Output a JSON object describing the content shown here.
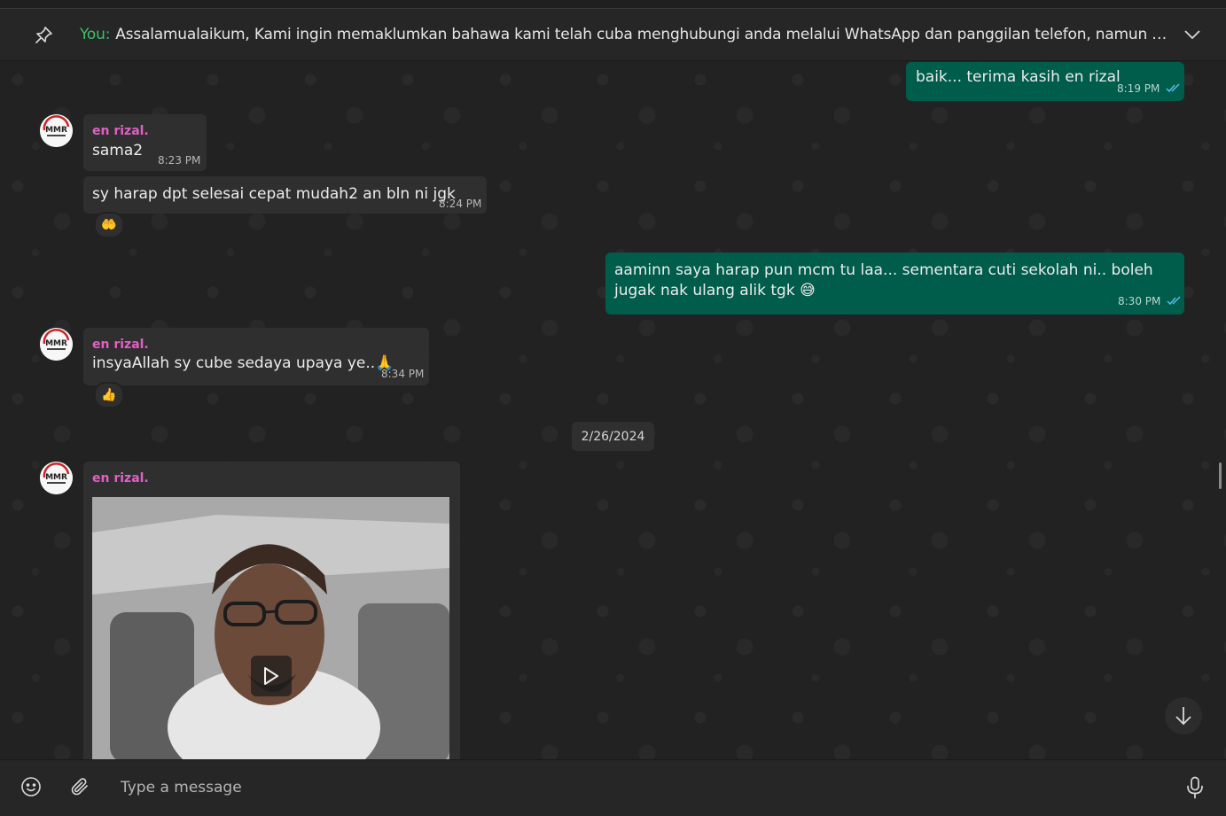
{
  "pinned": {
    "sender": "You:",
    "text": "Assalamualaikum,  Kami ingin memaklumkan bahawa kami telah cuba menghubungi anda melalui WhatsApp dan panggilan telefon, namun tidak mener..."
  },
  "messages": [
    {
      "direction": "out",
      "text": "baik... terima kasih en rizal",
      "time": "8:19 PM"
    },
    {
      "direction": "in",
      "sender": "en rizal.",
      "text": "sama2",
      "time": "8:23 PM"
    },
    {
      "direction": "in",
      "text": "sy harap dpt selesai cepat mudah2 an bln ni jgk",
      "time": "8:24 PM",
      "reaction": "🤲"
    },
    {
      "direction": "out",
      "text": "aaminn saya harap pun mcm tu laa... sementara cuti sekolah ni.. boleh jugak nak ulang alik  tgk 😅",
      "time": "8:30 PM"
    },
    {
      "direction": "in",
      "sender": "en rizal.",
      "text": "insyaAllah sy cube sedaya upaya ye..🙏",
      "time": "8:34 PM",
      "reaction": "👍"
    },
    {
      "direction": "in",
      "sender": "en rizal.",
      "type": "video"
    }
  ],
  "date_divider": "2/26/2024",
  "composer": {
    "placeholder": "Type a message"
  },
  "avatar_text": "MMR",
  "colors": {
    "outgoing_bubble": "#005c4b",
    "incoming_bubble": "#2f2f2f",
    "sender_name": "#e160c4",
    "you_label": "#3fbf6b"
  },
  "icons": [
    "pin-icon",
    "chevron-down-icon",
    "double-check-icon",
    "play-icon",
    "arrow-down-icon",
    "emoji-icon",
    "attach-icon",
    "mic-icon"
  ]
}
